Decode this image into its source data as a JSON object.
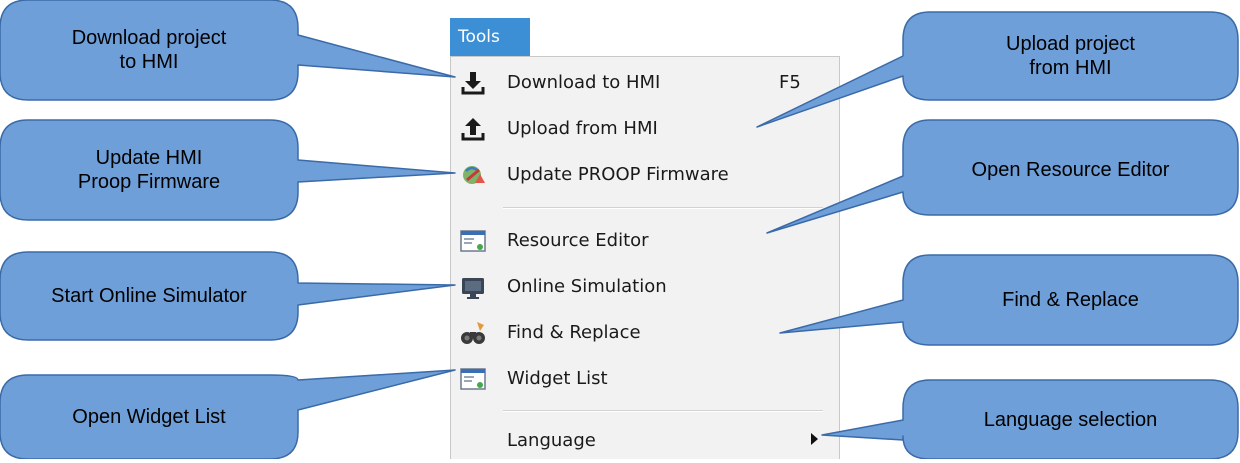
{
  "menu": {
    "title": "Tools",
    "items": [
      {
        "label": "Download to HMI",
        "shortcut": "F5",
        "icon": "download-icon"
      },
      {
        "label": "Upload from HMI",
        "icon": "upload-icon"
      },
      {
        "label": "Update PROOP Firmware",
        "icon": "firmware-update-icon"
      },
      {
        "label": "Resource Editor",
        "icon": "resource-editor-icon"
      },
      {
        "label": "Online Simulation",
        "icon": "monitor-icon"
      },
      {
        "label": "Find & Replace",
        "icon": "binoculars-icon"
      },
      {
        "label": "Widget List",
        "icon": "widget-list-icon"
      },
      {
        "label": "Language",
        "icon": "submenu-arrow-icon"
      }
    ]
  },
  "callouts": {
    "download": "Download project\nto HMI",
    "update": "Update HMI\nProop Firmware",
    "simulator": "Start Online Simulator",
    "widget_list": "Open Widget List",
    "upload": "Upload project\nfrom HMI",
    "resource": "Open Resource Editor",
    "find": "Find & Replace",
    "language": "Language selection"
  },
  "colors": {
    "callout_fill": "#6f9fd8",
    "callout_stroke": "#3a6aa8",
    "menu_bg": "#f2f2f2",
    "title_bg": "#3c8fd4"
  }
}
